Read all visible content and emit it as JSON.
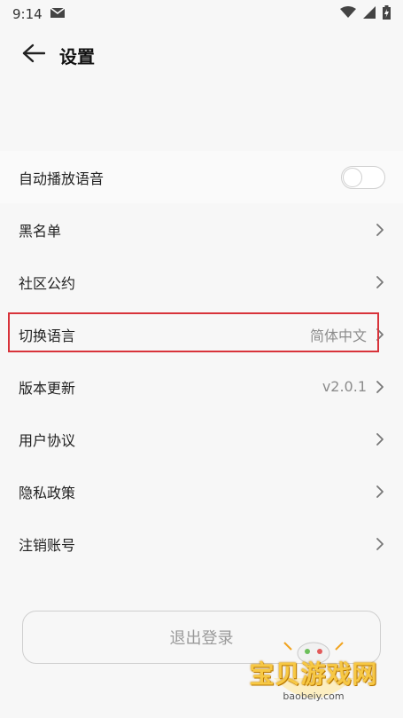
{
  "status_bar": {
    "time": "9:14",
    "icons": [
      "mail-icon",
      "wifi-icon",
      "cell-signal-icon",
      "battery-icon"
    ]
  },
  "header": {
    "back_icon": "arrow-left-icon",
    "title": "设置"
  },
  "settings": {
    "auto_play_voice": {
      "label": "自动播放语音",
      "toggle_on": false
    },
    "blacklist": {
      "label": "黑名单"
    },
    "community_rules": {
      "label": "社区公约"
    },
    "switch_language": {
      "label": "切换语言",
      "value": "简体中文"
    },
    "version_update": {
      "label": "版本更新",
      "value": "v2.0.1"
    },
    "user_agreement": {
      "label": "用户协议"
    },
    "privacy_policy": {
      "label": "隐私政策"
    },
    "delete_account": {
      "label": "注销账号"
    }
  },
  "logout": {
    "label": "退出登录"
  },
  "watermark": {
    "text": "宝贝游戏网",
    "url": "baobeiy.com"
  },
  "colors": {
    "highlight": "#d8333a",
    "muted_text": "#8c8c8c"
  }
}
